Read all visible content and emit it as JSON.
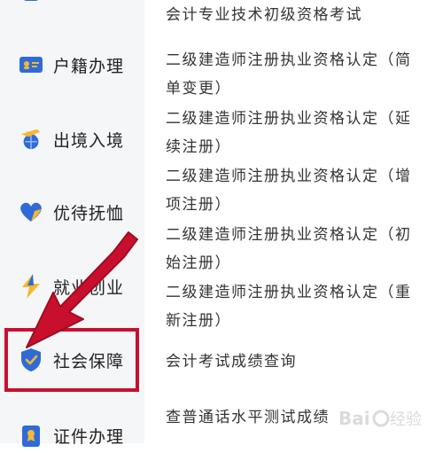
{
  "sidebar": {
    "items": [
      {
        "label": "",
        "icon": "category-icon"
      },
      {
        "label": "户籍办理",
        "icon": "id-card-icon"
      },
      {
        "label": "出境入境",
        "icon": "globe-plane-icon"
      },
      {
        "label": "优待抚恤",
        "icon": "heart-icon"
      },
      {
        "label": "就业创业",
        "icon": "lightning-icon"
      },
      {
        "label": "社会保障",
        "icon": "shield-check-icon",
        "selected": true
      },
      {
        "label": "证件办理",
        "icon": "certificate-icon"
      }
    ]
  },
  "services": [
    "会计专业技术初级资格考试",
    "二级建造师注册执业资格认定（简单变更）",
    "二级建造师注册执业资格认定（延续注册）",
    "二级建造师注册执业资格认定（增项注册）",
    "二级建造师注册执业资格认定（初始注册）",
    "二级建造师注册执业资格认定（重新注册）",
    "会计考试成绩查询",
    "查普通话水平测试成绩"
  ],
  "annotation": {
    "color": "#c8102e"
  },
  "watermark": {
    "text": "Baidu经验"
  },
  "colors": {
    "accent": "#2f6bd8",
    "sidebar_bg": "#f5f6f8",
    "icon_yellow": "#f5b82e"
  }
}
